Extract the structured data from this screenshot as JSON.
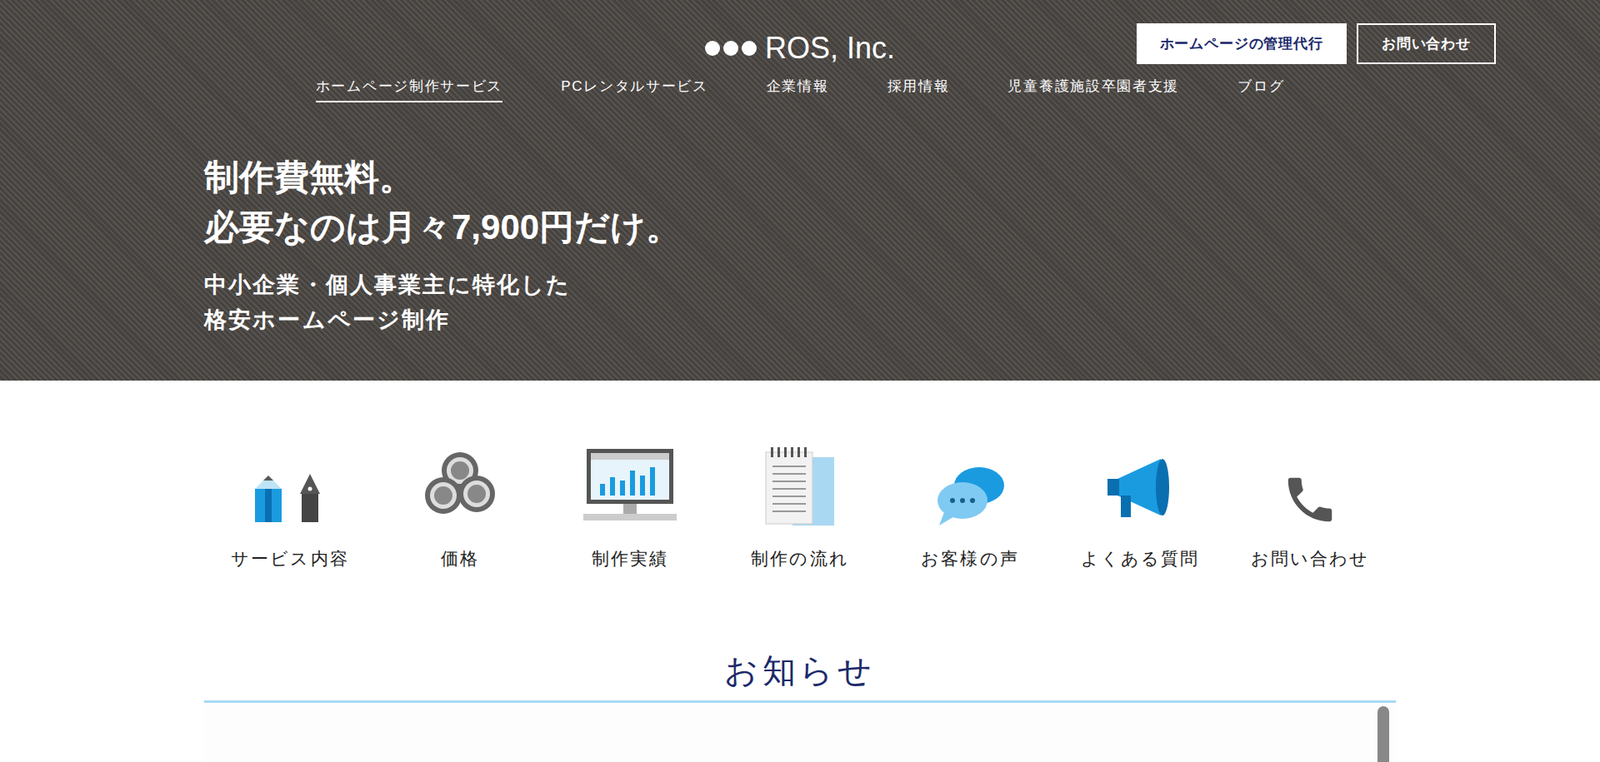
{
  "header": {
    "logo": "ROS, Inc.",
    "buttons": [
      {
        "label": "ホームページの管理代行",
        "kind": "filled"
      },
      {
        "label": "お問い合わせ",
        "kind": "outline"
      }
    ]
  },
  "nav": [
    {
      "label": "ホームページ制作サービス",
      "selected": true
    },
    {
      "label": "PCレンタルサービス",
      "selected": false
    },
    {
      "label": "企業情報",
      "selected": false
    },
    {
      "label": "採用情報",
      "selected": false
    },
    {
      "label": "児童養護施設卒園者支援",
      "selected": false
    },
    {
      "label": "ブログ",
      "selected": false
    }
  ],
  "hero": {
    "title": [
      "制作費無料。",
      "必要なのは月々7,900円だけ。"
    ],
    "subtitle": [
      "中小企業・個人事業主に特化した",
      "格安ホームページ制作"
    ]
  },
  "menu": [
    {
      "label": "サービス内容"
    },
    {
      "label": "価格"
    },
    {
      "label": "制作実績"
    },
    {
      "label": "制作の流れ"
    },
    {
      "label": "お客様の声"
    },
    {
      "label": "よくある質問"
    },
    {
      "label": "お問い合わせ"
    }
  ],
  "news": {
    "heading": "お知らせ"
  }
}
